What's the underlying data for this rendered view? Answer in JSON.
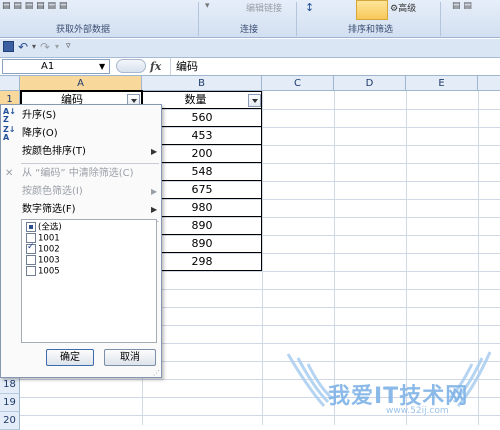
{
  "ribbon": {
    "groups": [
      {
        "label": "获取外部数据"
      },
      {
        "label": "连接"
      },
      {
        "label": "排序和筛选"
      }
    ],
    "edit_links_label": "编辑链接",
    "advanced_label": "高级"
  },
  "name_box": {
    "value": "A1"
  },
  "formula_bar": {
    "fx_label": "fx",
    "content": "编码"
  },
  "columns": [
    "A",
    "B",
    "C",
    "D",
    "E"
  ],
  "rows": [
    "1",
    "18",
    "19",
    "20"
  ],
  "sheet": {
    "a1": "编码",
    "b1": "数量",
    "b_values": [
      "560",
      "453",
      "200",
      "548",
      "675",
      "980",
      "890",
      "890",
      "298"
    ]
  },
  "filter_menu": {
    "sort_asc": "升序(S)",
    "sort_desc": "降序(O)",
    "sort_by_color": "按颜色排序(T)",
    "clear_filter": "从 “编码” 中清除筛选(C)",
    "filter_by_color": "按颜色筛选(I)",
    "number_filters": "数字筛选(F)",
    "list": [
      {
        "label": "(全选)",
        "state": "partial"
      },
      {
        "label": "1001",
        "state": "unchecked"
      },
      {
        "label": "1002",
        "state": "checked"
      },
      {
        "label": "1003",
        "state": "unchecked"
      },
      {
        "label": "1005",
        "state": "unchecked"
      }
    ],
    "ok_label": "确定",
    "cancel_label": "取消"
  },
  "watermark": {
    "text": "我爱IT技术网",
    "url": "www.52ij.com"
  },
  "colors": {
    "accent": "#f8c85a",
    "header_bg": "#e4ecf7",
    "watermark": "#7fb3e6"
  }
}
